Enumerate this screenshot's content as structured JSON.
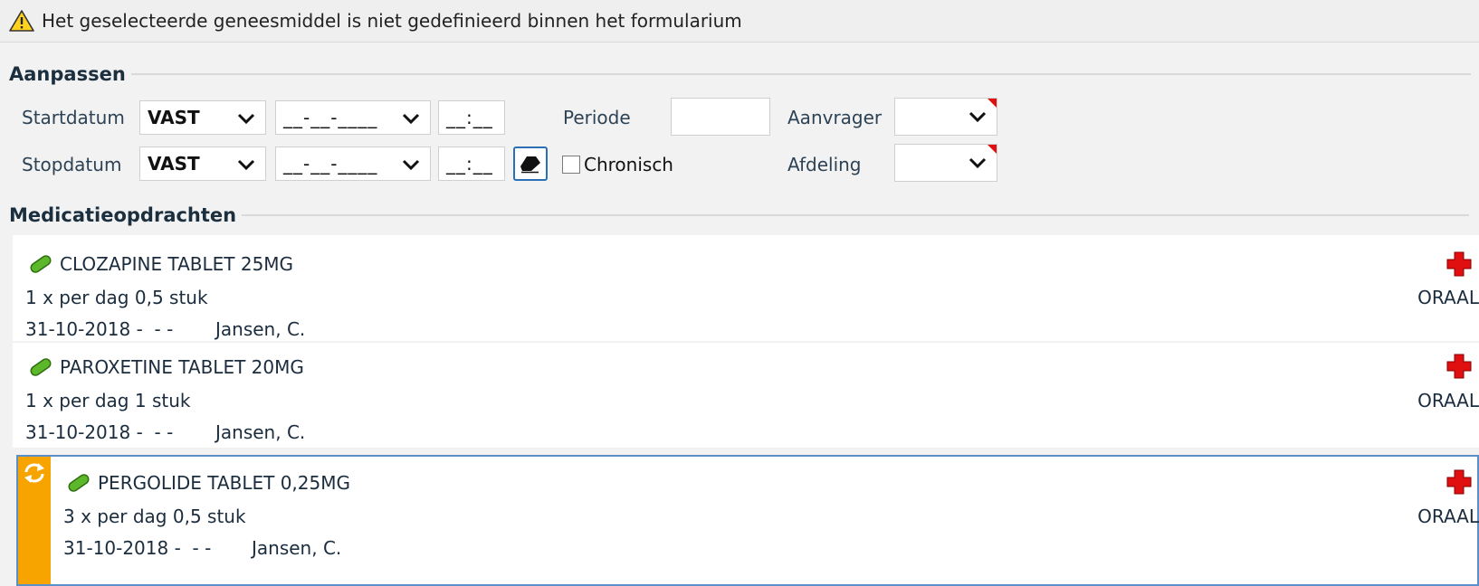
{
  "warning": {
    "text": "Het geselecteerde geneesmiddel is niet gedefinieerd binnen het formularium",
    "icon": "warning-icon"
  },
  "aanpassen": {
    "title": "Aanpassen",
    "start_label": "Startdatum",
    "start_mode": "VAST",
    "start_date": "__-__-____",
    "start_time": "__:__",
    "periode_label": "Periode",
    "periode_value": "",
    "aanvrager_label": "Aanvrager",
    "aanvrager_value": "",
    "stop_label": "Stopdatum",
    "stop_mode": "VAST",
    "stop_date": "__-__-____",
    "stop_time": "__:__",
    "chronisch_label": "Chronisch",
    "chronisch_checked": false,
    "afdeling_label": "Afdeling",
    "afdeling_value": ""
  },
  "medicatie": {
    "title": "Medicatieopdrachten",
    "items": [
      {
        "name": "CLOZAPINE TABLET  25MG",
        "dose": "1 x per dag 0,5 stuk",
        "period": "31-10-2018 -  - -",
        "prescriber": "Jansen, C.",
        "route": "ORAAL",
        "selected": false
      },
      {
        "name": "PAROXETINE TABLET 20MG",
        "dose": "1 x per dag 1 stuk",
        "period": "31-10-2018 -  - -",
        "prescriber": "Jansen, C.",
        "route": "ORAAL",
        "selected": false
      },
      {
        "name": "PERGOLIDE TABLET 0,25MG",
        "dose": "3 x per dag 0,5 stuk",
        "period": "31-10-2018 -  - -",
        "prescriber": "Jansen, C.",
        "route": "ORAAL",
        "selected": true
      }
    ]
  },
  "colors": {
    "accent": "#f7a400",
    "cross": "#e01010",
    "pill": "#5cb82a",
    "selection": "#5b8fc7"
  }
}
